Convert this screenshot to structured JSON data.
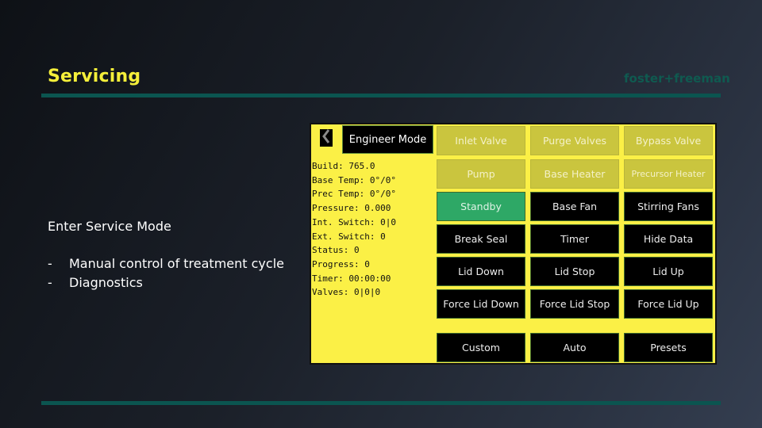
{
  "slide": {
    "title": "Servicing",
    "brand": "foster+freeman",
    "lead": "Enter Service Mode",
    "bullets": [
      {
        "marker": "-",
        "text": "Manual control of treatment cycle"
      },
      {
        "marker": "-",
        "text": "Diagnostics"
      }
    ]
  },
  "panel": {
    "back_icon": "chevron-left-icon",
    "mode_label": "Engineer Mode",
    "readout": [
      "Build: 765.0",
      "Base Temp: 0°/0°",
      "Prec Temp: 0°/0°",
      "Pressure: 0.000",
      "Int. Switch: 0|0",
      "Ext. Switch: 0",
      "Status: 0",
      "Progress: 0",
      "Timer: 00:00:00",
      "Valves: 0|0|0"
    ],
    "buttons": [
      {
        "label": "Inlet Valve",
        "state": "disabled"
      },
      {
        "label": "Purge Valves",
        "state": "disabled"
      },
      {
        "label": "Bypass Valve",
        "state": "disabled"
      },
      {
        "label": "Pump",
        "state": "disabled"
      },
      {
        "label": "Base Heater",
        "state": "disabled"
      },
      {
        "label": "Precursor Heater",
        "state": "disabled"
      },
      {
        "label": "Standby",
        "state": "active"
      },
      {
        "label": "Base Fan",
        "state": "normal"
      },
      {
        "label": "Stirring Fans",
        "state": "normal"
      },
      {
        "label": "Break Seal",
        "state": "normal"
      },
      {
        "label": "Timer",
        "state": "normal"
      },
      {
        "label": "Hide Data",
        "state": "normal"
      },
      {
        "label": "Lid Down",
        "state": "normal"
      },
      {
        "label": "Lid Stop",
        "state": "normal"
      },
      {
        "label": "Lid Up",
        "state": "normal"
      },
      {
        "label": "Force Lid Down",
        "state": "normal"
      },
      {
        "label": "Force Lid Stop",
        "state": "normal"
      },
      {
        "label": "Force Lid Up",
        "state": "normal"
      },
      {
        "label": "Custom",
        "state": "normal"
      },
      {
        "label": "Auto",
        "state": "normal"
      },
      {
        "label": "Presets",
        "state": "normal"
      }
    ]
  },
  "colors": {
    "title": "#f5ef3a",
    "panel": "#fbf046",
    "active": "#2ea866",
    "disabled": "#cac53e",
    "rule": "#0b5550"
  }
}
